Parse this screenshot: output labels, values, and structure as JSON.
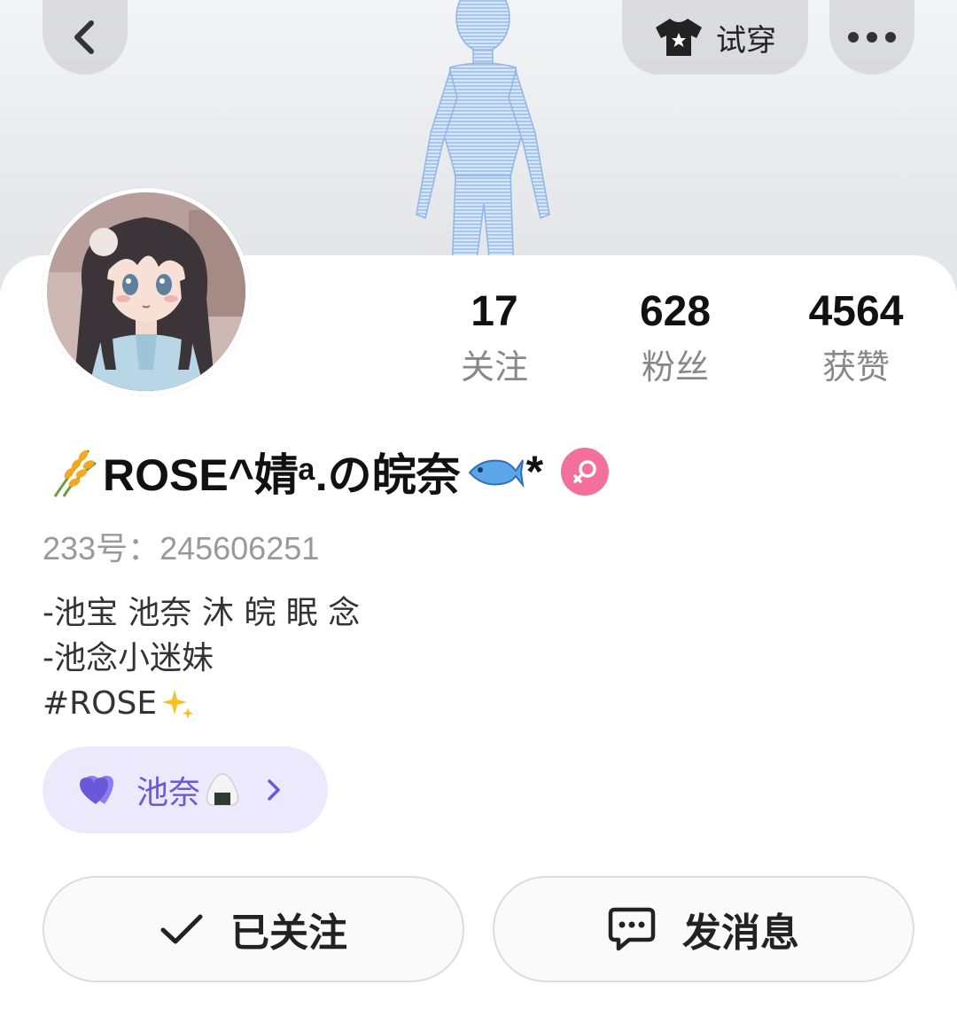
{
  "header": {
    "tryon_label": "试穿"
  },
  "profile": {
    "name": "ROSE^婧ᵃ.の皖奈",
    "name_suffix": "*",
    "uid_text": "233号：245606251",
    "gender": "female"
  },
  "stats": [
    {
      "value": "17",
      "label": "关注"
    },
    {
      "value": "628",
      "label": "粉丝"
    },
    {
      "value": "4564",
      "label": "获赞"
    }
  ],
  "bio": {
    "lines": [
      "-池宝 池奈 沐 皖 眠 念",
      "-池念小迷妹",
      "#ROSE"
    ]
  },
  "group_chip": {
    "label": "池奈"
  },
  "actions": {
    "follow_label": "已关注",
    "message_label": "发消息"
  },
  "colors": {
    "accent_purple": "#6a58d8",
    "chip_bg": "#ece9fd",
    "gender_pink": "#f2709b",
    "muted_text": "#888888"
  },
  "icons": [
    "back-icon",
    "tshirt-icon",
    "more-icon",
    "wheat-icon",
    "fish-icon",
    "female-icon",
    "sparkle-icon",
    "hearts-icon",
    "riceball-icon",
    "chevron-right-icon",
    "check-icon",
    "chat-bubble-icon"
  ]
}
